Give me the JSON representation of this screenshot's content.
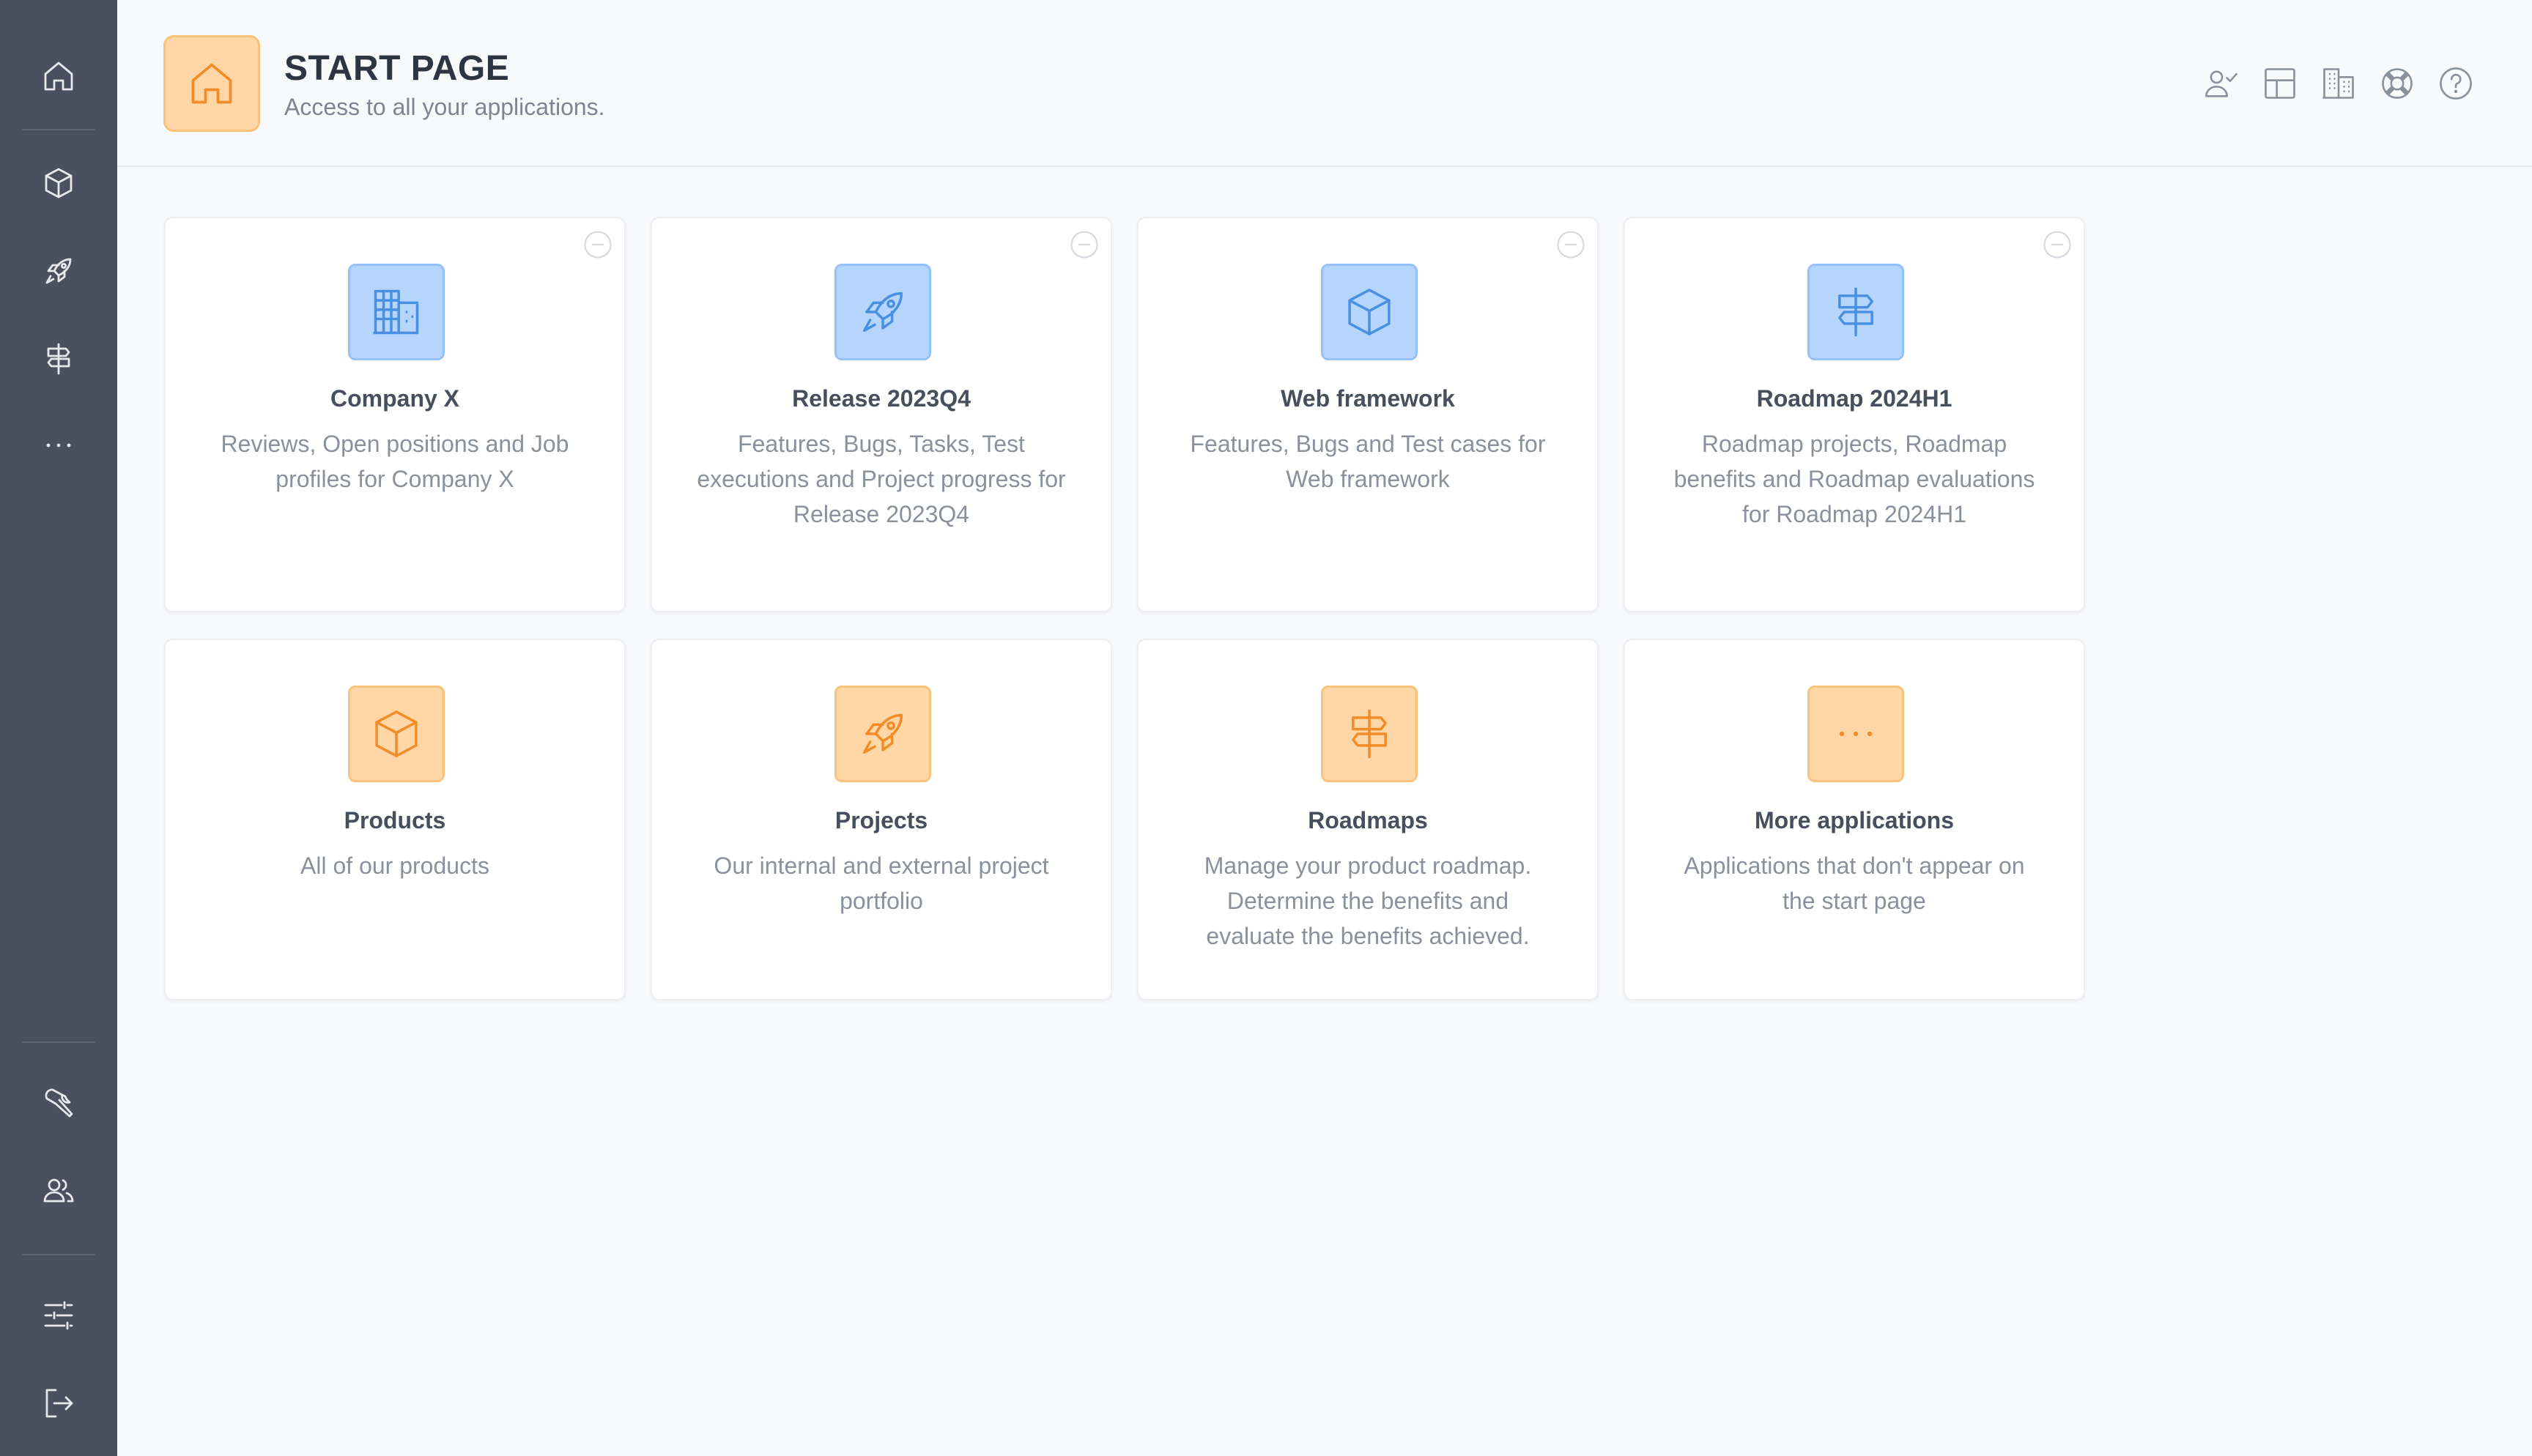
{
  "header": {
    "title": "START PAGE",
    "subtitle": "Access to all your applications."
  },
  "sidebar": {
    "top_items": [
      {
        "icon": "home-icon"
      },
      {
        "icon": "box-icon"
      },
      {
        "icon": "rocket-icon"
      },
      {
        "icon": "signpost-icon"
      },
      {
        "icon": "more-icon"
      }
    ],
    "bottom_items": [
      {
        "icon": "wrench-icon"
      },
      {
        "icon": "users-icon"
      },
      {
        "icon": "sliders-icon"
      },
      {
        "icon": "logout-icon"
      }
    ]
  },
  "toolbar": {
    "icons": [
      "user-check-icon",
      "layout-icon",
      "buildings-icon",
      "lifebuoy-icon",
      "help-icon"
    ]
  },
  "cards": [
    {
      "title": "Company X",
      "description": "Reviews, Open positions and Job profiles for Company X",
      "icon": "building-icon",
      "color": "blue",
      "removable": true
    },
    {
      "title": "Release 2023Q4",
      "description": "Features, Bugs, Tasks, Test executions and Project progress for Release 2023Q4",
      "icon": "rocket-icon",
      "color": "blue",
      "removable": true
    },
    {
      "title": "Web framework",
      "description": "Features, Bugs and Test cases for Web framework",
      "icon": "box-icon",
      "color": "blue",
      "removable": true
    },
    {
      "title": "Roadmap 2024H1",
      "description": "Roadmap projects, Roadmap benefits and Roadmap evaluations for Roadmap 2024H1",
      "icon": "signpost-icon",
      "color": "blue",
      "removable": true
    },
    {
      "title": "Products",
      "description": "All of our products",
      "icon": "box-icon",
      "color": "orange",
      "removable": false
    },
    {
      "title": "Projects",
      "description": "Our internal and external project portfolio",
      "icon": "rocket-icon",
      "color": "orange",
      "removable": false
    },
    {
      "title": "Roadmaps",
      "description": "Manage your product roadmap. Determine the benefits and evaluate the benefits achieved.",
      "icon": "signpost-icon",
      "color": "orange",
      "removable": false
    },
    {
      "title": "More applications",
      "description": "Applications that don't appear on the start page",
      "icon": "more-icon",
      "color": "orange",
      "removable": false
    }
  ],
  "colors": {
    "sidebar_bg": "#4a515e",
    "accent_blue": "#4a90e2",
    "accent_orange": "#f28c28",
    "page_bg": "#f8f9fb"
  }
}
